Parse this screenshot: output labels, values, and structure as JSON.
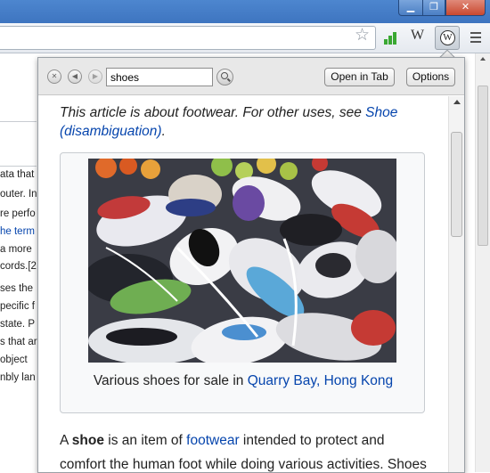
{
  "colors": {
    "link": "#0645ad",
    "text": "#222222",
    "titlebar": "#4d86cf",
    "close_button": "#c9482f"
  },
  "window": {
    "minimize_glyph": "▁",
    "maximize_glyph": "❐",
    "close_glyph": "✕"
  },
  "browser": {
    "toolbar_icons": [
      "star-icon",
      "signal-bars-icon",
      "wikipedia-w-icon",
      "wikipedia-extension-icon",
      "menu-icon"
    ],
    "wiki_w": "W",
    "wiki_ext_letter": "W"
  },
  "background_page": {
    "lines": [
      {
        "text": "ata that",
        "link": false
      },
      {
        "text": "outer. In",
        "link": false
      },
      {
        "text": "re perfo",
        "link": false
      },
      {
        "text": "he term",
        "link": true
      },
      {
        "text": "a more",
        "link": false
      },
      {
        "text": "cords.[2",
        "link": false
      },
      {
        "text": "ses the",
        "link": false
      },
      {
        "text": "pecific f",
        "link": false
      },
      {
        "text": "state. P",
        "link": false
      },
      {
        "text": "s that ar",
        "link": false
      },
      {
        "text": "object",
        "link": false
      },
      {
        "text": "nbly lan",
        "link": false
      }
    ]
  },
  "popup": {
    "toolbar": {
      "search_value": "shoes",
      "open_in_tab_label": "Open in Tab",
      "options_label": "Options",
      "nav_icons": [
        "close-icon",
        "back-icon",
        "forward-icon"
      ]
    },
    "hatnote": {
      "prefix": "This article is about footwear. For other uses, see ",
      "link": "Shoe (disambiguation)",
      "suffix": "."
    },
    "figure": {
      "image_icon": "shoe-pile-photo",
      "caption_prefix": "Various shoes for sale in ",
      "caption_link": "Quarry Bay, Hong Kong"
    },
    "body": {
      "lead_start": "A ",
      "term": "shoe",
      "mid1": " is an item of ",
      "link1": "footwear",
      "mid2": " intended to protect and comfort the human foot while doing various activities. Shoes"
    }
  }
}
